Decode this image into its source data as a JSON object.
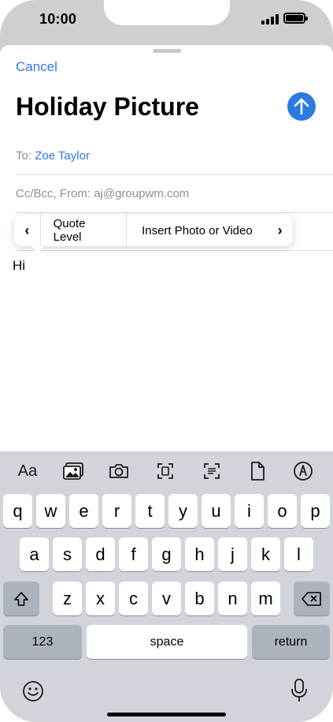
{
  "status_bar": {
    "time": "10:00"
  },
  "compose": {
    "cancel_label": "Cancel",
    "subject": "Holiday Picture",
    "to_label": "To:",
    "to_value": "Zoe Taylor",
    "ccbcc_label": "Cc/Bcc, From:",
    "from_value": "aj@groupwm.com",
    "body": "Hi"
  },
  "popover": {
    "prev_glyph": "‹",
    "next_glyph": "›",
    "items": [
      "Quote Level",
      "Insert Photo or Video"
    ]
  },
  "keyboard": {
    "toolbar_aa": "Aa",
    "row1": [
      "q",
      "w",
      "e",
      "r",
      "t",
      "y",
      "u",
      "i",
      "o",
      "p"
    ],
    "row2": [
      "a",
      "s",
      "d",
      "f",
      "g",
      "h",
      "j",
      "k",
      "l"
    ],
    "row3": [
      "z",
      "x",
      "c",
      "v",
      "b",
      "n",
      "m"
    ],
    "numbers_label": "123",
    "space_label": "space",
    "return_label": "return"
  },
  "colors": {
    "accent": "#2d7be0"
  }
}
